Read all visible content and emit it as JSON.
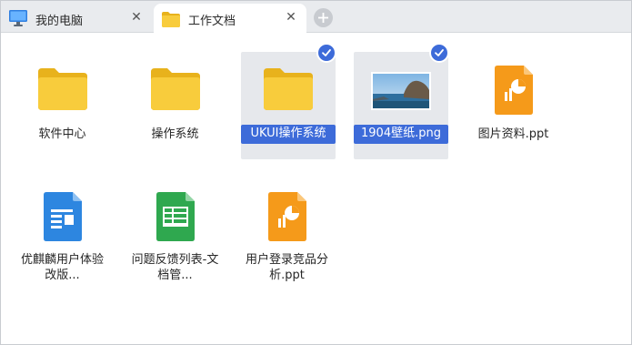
{
  "tabs": [
    {
      "label": "我的电脑",
      "icon": "computer-icon",
      "active": false
    },
    {
      "label": "工作文档",
      "icon": "folder-icon",
      "active": true
    }
  ],
  "new_tab_icon": "plus-icon",
  "close_glyph": "✕",
  "files": [
    {
      "name": "软件中心",
      "type": "folder",
      "selected": false
    },
    {
      "name": "操作系统",
      "type": "folder",
      "selected": false
    },
    {
      "name": "UKUI操作系统",
      "type": "folder",
      "selected": true
    },
    {
      "name": "1904壁纸.png",
      "type": "image",
      "selected": true
    },
    {
      "name": "图片资料.ppt",
      "type": "ppt",
      "selected": false
    },
    {
      "name": "优麒麟用户体验改版...",
      "type": "doc",
      "selected": false
    },
    {
      "name": "问题反馈列表-文档管...",
      "type": "sheet",
      "selected": false
    },
    {
      "name": "用户登录竞品分析.ppt",
      "type": "ppt",
      "selected": false
    }
  ],
  "colors": {
    "accent": "#3d6bd9",
    "folder": "#f6c532",
    "ppt": "#f59a1a",
    "doc": "#2d86e0",
    "sheet": "#2fa84f"
  }
}
